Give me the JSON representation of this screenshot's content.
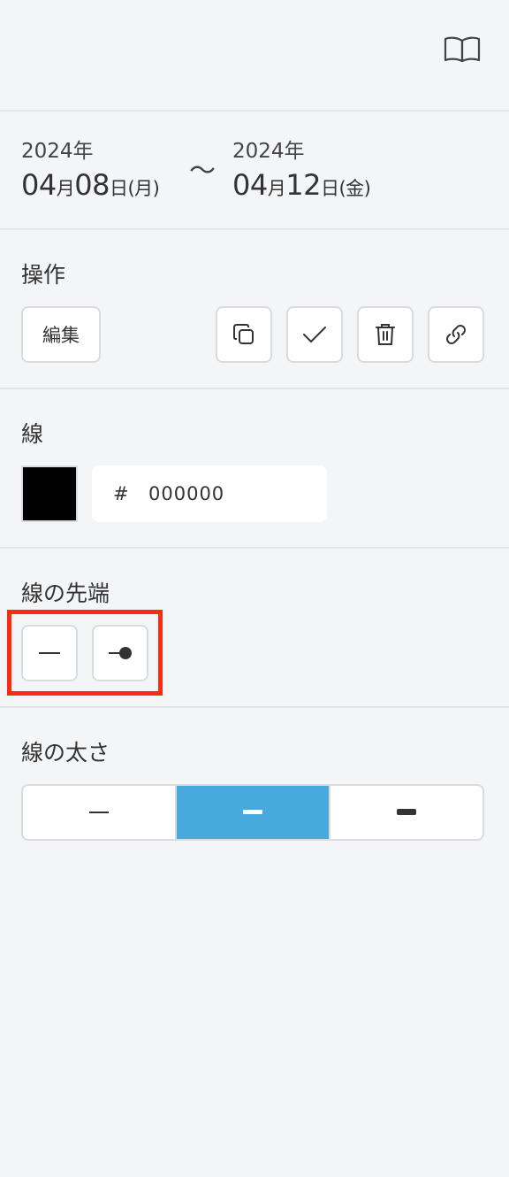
{
  "header": {
    "icon": "book-open-icon"
  },
  "date_range": {
    "start": {
      "year": "2024",
      "year_unit": "年",
      "month": "04",
      "month_unit": "月",
      "day": "08",
      "day_unit": "日",
      "weekday": "(月)"
    },
    "separator": "〜",
    "end": {
      "year": "2024",
      "year_unit": "年",
      "month": "04",
      "month_unit": "月",
      "day": "12",
      "day_unit": "日",
      "weekday": "(金)"
    }
  },
  "operations": {
    "title": "操作",
    "edit_label": "編集",
    "actions": [
      "duplicate-icon",
      "check-icon",
      "trash-icon",
      "link-icon"
    ]
  },
  "line": {
    "title": "線",
    "color": "#000000",
    "hash": "#",
    "hex_value": "000000"
  },
  "line_end": {
    "title": "線の先端",
    "options": [
      "line-end-plain-icon",
      "line-end-dot-icon"
    ]
  },
  "line_width": {
    "title": "線の太さ",
    "options": [
      "thin",
      "medium",
      "thick"
    ],
    "selected": "medium",
    "accent_color": "#47a9dd"
  }
}
